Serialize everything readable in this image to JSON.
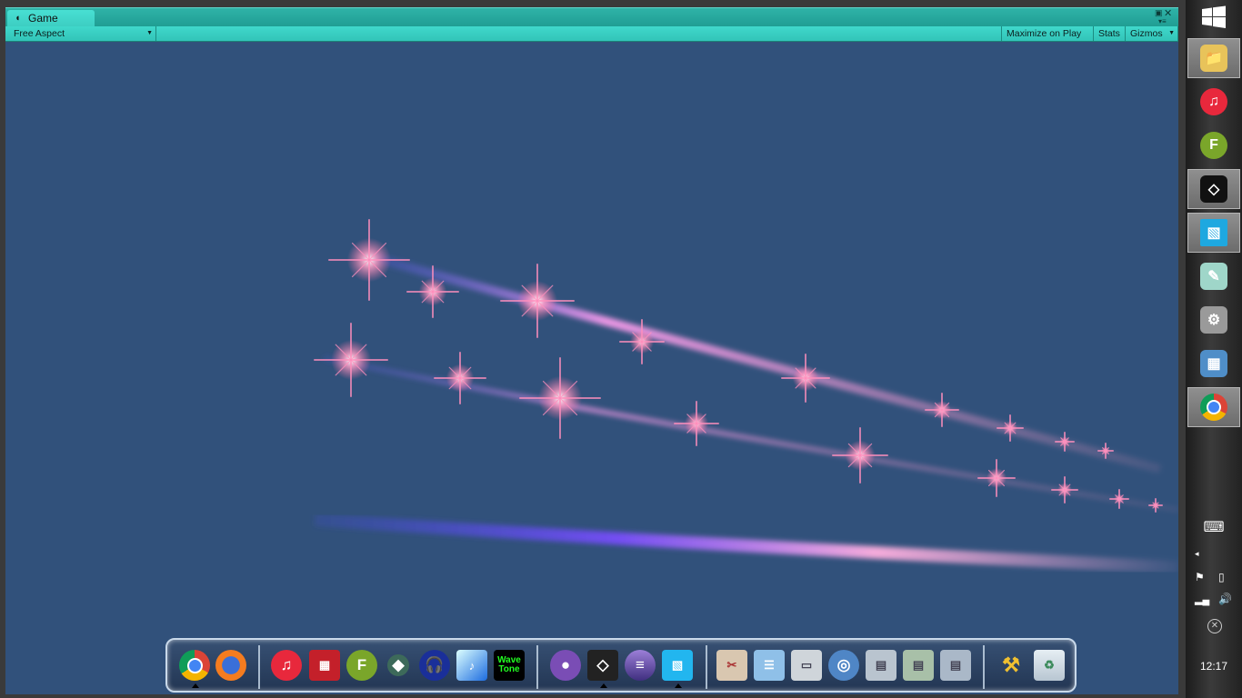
{
  "window": {
    "tab_label": "Game",
    "aspect_label": "Free Aspect",
    "maximize_label": "Maximize on Play",
    "stats_label": "Stats",
    "gizmos_label": "Gizmos"
  },
  "taskbar": {
    "apps": [
      "file-explorer-icon",
      "itunes-icon",
      "fl-studio-icon",
      "unity-icon",
      "image-viewer-icon",
      "notepad-icon",
      "game-controller-icon",
      "calculator-icon",
      "chrome-icon"
    ],
    "clock": "12:17"
  },
  "dock": {
    "groups": [
      [
        "chrome",
        "firefox"
      ],
      [
        "itunes",
        "monitor-app",
        "fl-studio",
        "krita",
        "audacity",
        "music-visualizer",
        "wavetone"
      ],
      [
        "github",
        "unity",
        "eclipse",
        "image-viewer"
      ],
      [
        "file-tools",
        "network-settings",
        "computer",
        "internet",
        "folder",
        "folder-open",
        "documents"
      ],
      [
        "system-tools",
        "recycle-bin"
      ]
    ],
    "wavetone_label": "Wave Tone"
  },
  "colors": {
    "accent": "#3ccdc1",
    "viewport": "#31517b"
  }
}
